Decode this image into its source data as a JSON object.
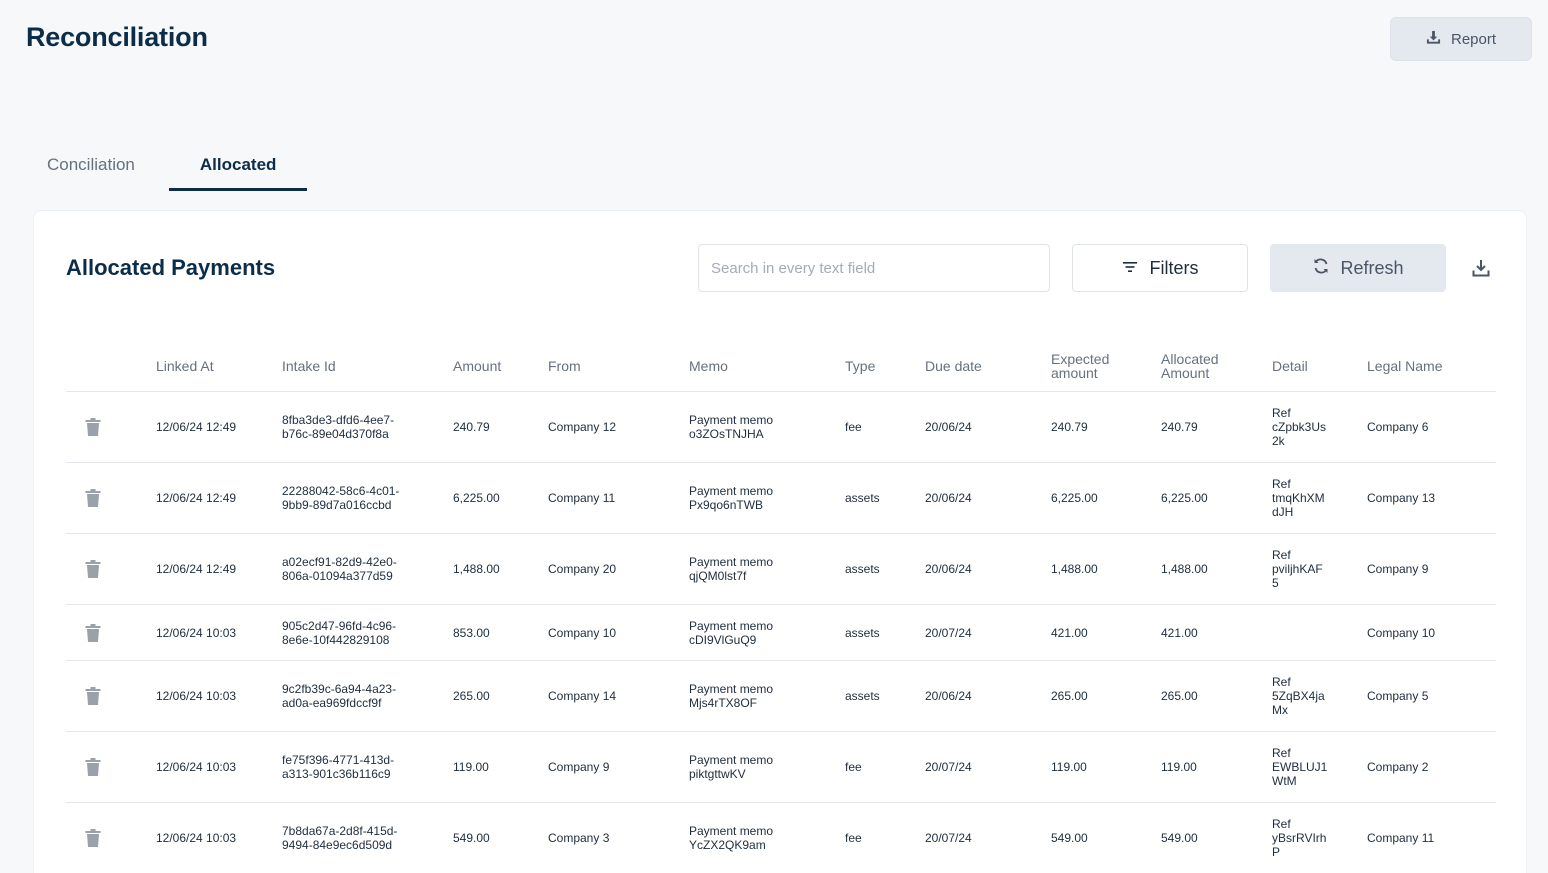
{
  "page": {
    "title": "Reconciliation",
    "report_label": "Report"
  },
  "tabs": [
    {
      "label": "Conciliation",
      "active": false
    },
    {
      "label": "Allocated",
      "active": true
    }
  ],
  "card": {
    "title": "Allocated Payments",
    "search_placeholder": "Search in every text field",
    "filters_label": "Filters",
    "refresh_label": "Refresh"
  },
  "table": {
    "headers": {
      "linked_at": "Linked At",
      "intake_id": "Intake Id",
      "amount": "Amount",
      "from": "From",
      "memo": "Memo",
      "type": "Type",
      "due_date": "Due date",
      "expected_amount_1": "Expected",
      "expected_amount_2": "amount",
      "allocated_amount_1": "Allocated",
      "allocated_amount_2": "Amount",
      "detail": "Detail",
      "legal_name": "Legal Name"
    },
    "rows": [
      {
        "linked_at": "12/06/24 12:49",
        "intake_1": "8fba3de3-dfd6-4ee7-",
        "intake_2": "b76c-89e04d370f8a",
        "amount": "240.79",
        "from": "Company 12",
        "memo_1": "Payment memo",
        "memo_2": "o3ZOsTNJHA",
        "type": "fee",
        "due": "20/06/24",
        "expected": "240.79",
        "allocated": "240.79",
        "detail_1": "Ref",
        "detail_2": "cZpbk3Us",
        "detail_3": "2k",
        "legal": "Company 6"
      },
      {
        "linked_at": "12/06/24 12:49",
        "intake_1": "22288042-58c6-4c01-",
        "intake_2": "9bb9-89d7a016ccbd",
        "amount": "6,225.00",
        "from": "Company 11",
        "memo_1": "Payment memo",
        "memo_2": "Px9qo6nTWB",
        "type": "assets",
        "due": "20/06/24",
        "expected": "6,225.00",
        "allocated": "6,225.00",
        "detail_1": "Ref",
        "detail_2": "tmqKhXM",
        "detail_3": "dJH",
        "legal": "Company 13"
      },
      {
        "linked_at": "12/06/24 12:49",
        "intake_1": "a02ecf91-82d9-42e0-",
        "intake_2": "806a-01094a377d59",
        "amount": "1,488.00",
        "from": "Company 20",
        "memo_1": "Payment memo",
        "memo_2": "qjQM0lst7f",
        "type": "assets",
        "due": "20/06/24",
        "expected": "1,488.00",
        "allocated": "1,488.00",
        "detail_1": "Ref",
        "detail_2": "pviljhKAF",
        "detail_3": "5",
        "legal": "Company 9"
      },
      {
        "linked_at": "12/06/24 10:03",
        "intake_1": "905c2d47-96fd-4c96-",
        "intake_2": "8e6e-10f442829108",
        "amount": "853.00",
        "from": "Company 10",
        "memo_1": "Payment memo",
        "memo_2": "cDI9VlGuQ9",
        "type": "assets",
        "due": "20/07/24",
        "expected": "421.00",
        "allocated": "421.00",
        "detail_1": "",
        "detail_2": "",
        "detail_3": "",
        "legal": "Company 10"
      },
      {
        "linked_at": "12/06/24 10:03",
        "intake_1": "9c2fb39c-6a94-4a23-",
        "intake_2": "ad0a-ea969fdccf9f",
        "amount": "265.00",
        "from": "Company 14",
        "memo_1": "Payment memo",
        "memo_2": "Mjs4rTX8OF",
        "type": "assets",
        "due": "20/06/24",
        "expected": "265.00",
        "allocated": "265.00",
        "detail_1": "Ref",
        "detail_2": "5ZqBX4ja",
        "detail_3": "Mx",
        "legal": "Company 5"
      },
      {
        "linked_at": "12/06/24 10:03",
        "intake_1": "fe75f396-4771-413d-",
        "intake_2": "a313-901c36b116c9",
        "amount": "119.00",
        "from": "Company 9",
        "memo_1": "Payment memo",
        "memo_2": "piktgttwKV",
        "type": "fee",
        "due": "20/07/24",
        "expected": "119.00",
        "allocated": "119.00",
        "detail_1": "Ref",
        "detail_2": "EWBLUJ1",
        "detail_3": "WtM",
        "legal": "Company 2"
      },
      {
        "linked_at": "12/06/24 10:03",
        "intake_1": "7b8da67a-2d8f-415d-",
        "intake_2": "9494-84e9ec6d509d",
        "amount": "549.00",
        "from": "Company 3",
        "memo_1": "Payment memo",
        "memo_2": "YcZX2QK9am",
        "type": "fee",
        "due": "20/07/24",
        "expected": "549.00",
        "allocated": "549.00",
        "detail_1": "Ref",
        "detail_2": "yBsrRVIrh",
        "detail_3": "P",
        "legal": "Company 11"
      }
    ]
  },
  "colors": {
    "title": "#0c2d4a",
    "muted": "#66717f",
    "button_bg": "#e4e8ef",
    "border": "#e4e7ec"
  },
  "icons": {
    "report": "download-icon",
    "filters": "filter-lines-icon",
    "refresh": "refresh-icon",
    "download": "download-icon",
    "row_action": "trash-icon"
  }
}
